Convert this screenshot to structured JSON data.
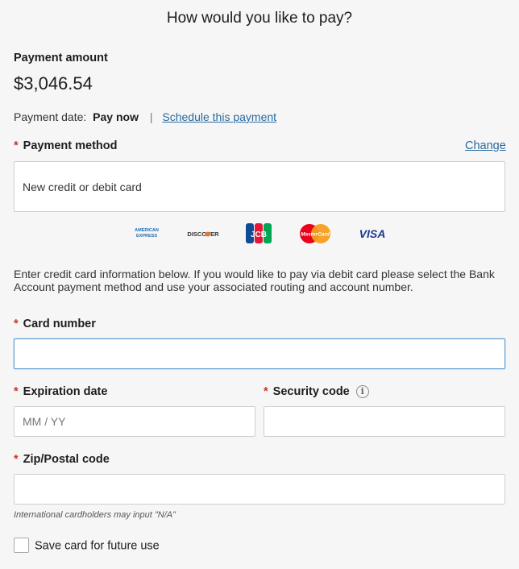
{
  "header": {
    "title": "How would you like to pay?"
  },
  "payment": {
    "amount_label": "Payment amount",
    "amount": "$3,046.54",
    "date_label": "Payment date:",
    "date_value": "Pay now",
    "separator": "|",
    "schedule_link": "Schedule this payment"
  },
  "method": {
    "required": "*",
    "label": "Payment method",
    "change_link": "Change",
    "selected": "New credit or debit card"
  },
  "card_brands": [
    "American Express",
    "Discover",
    "JCB",
    "MasterCard",
    "VISA"
  ],
  "card_brand_text": {
    "amex_line1": "AMERICAN",
    "amex_line2": "EXPRESS",
    "discover": "DISCOVER",
    "jcb": "JCB",
    "mastercard": "MasterCard",
    "visa": "VISA"
  },
  "info_text": "Enter credit card information below.  If you would like to pay via debit card please select the Bank Account payment method and use your associated routing and account number.",
  "form": {
    "card_number": {
      "label": "Card number",
      "value": "",
      "placeholder": ""
    },
    "expiration": {
      "label": "Expiration date",
      "value": "",
      "placeholder": "MM / YY"
    },
    "security": {
      "label": "Security code",
      "value": "",
      "placeholder": "",
      "info_icon": "i"
    },
    "zip": {
      "label": "Zip/Postal code",
      "value": "",
      "placeholder": ""
    },
    "zip_hint": "International cardholders may input \"N/A\"",
    "save_card": {
      "label": "Save card for future use",
      "checked": false
    }
  },
  "colors": {
    "required": "#c0392b",
    "link": "#2a6a9e",
    "focus_border": "#5b9bd5",
    "background": "#f6f6f6"
  }
}
